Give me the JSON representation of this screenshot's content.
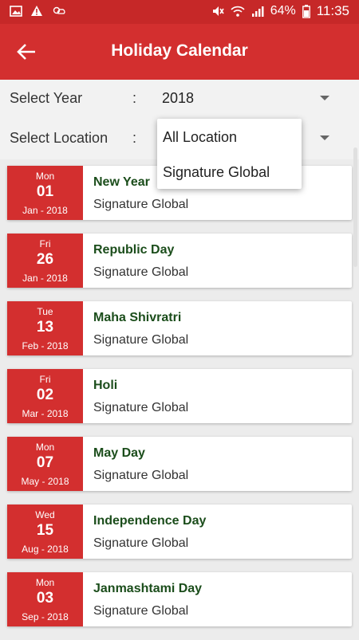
{
  "statusbar": {
    "battery_pct": "64%",
    "time": "11:35",
    "icons": [
      "image-icon",
      "alert-icon",
      "weather-icon",
      "mute-icon",
      "wifi-icon",
      "signal-icon",
      "battery-icon"
    ]
  },
  "appbar": {
    "title": "Holiday Calendar",
    "back_icon": "back-arrow-icon"
  },
  "filters": {
    "year": {
      "label": "Select Year",
      "separator": ":",
      "value": "2018"
    },
    "location": {
      "label": "Select Location",
      "separator": ":",
      "value": ""
    }
  },
  "location_dropdown": {
    "options": [
      "All Location",
      "Signature Global"
    ]
  },
  "holidays": [
    {
      "dow": "Mon",
      "day": "01",
      "month_year": "Jan - 2018",
      "name": "New Year",
      "location": "Signature Global"
    },
    {
      "dow": "Fri",
      "day": "26",
      "month_year": "Jan - 2018",
      "name": "Republic Day",
      "location": "Signature Global"
    },
    {
      "dow": "Tue",
      "day": "13",
      "month_year": "Feb - 2018",
      "name": "Maha Shivratri",
      "location": "Signature Global"
    },
    {
      "dow": "Fri",
      "day": "02",
      "month_year": "Mar - 2018",
      "name": "Holi",
      "location": "Signature Global"
    },
    {
      "dow": "Mon",
      "day": "07",
      "month_year": "May - 2018",
      "name": "May Day",
      "location": "Signature Global"
    },
    {
      "dow": "Wed",
      "day": "15",
      "month_year": "Aug - 2018",
      "name": "Independence Day",
      "location": "Signature Global"
    },
    {
      "dow": "Mon",
      "day": "03",
      "month_year": "Sep - 2018",
      "name": "Janmashtami Day",
      "location": "Signature Global"
    }
  ],
  "colors": {
    "primary": "#d32f2f",
    "statusbar": "#c62828",
    "holiday_name": "#1b4d1b"
  }
}
